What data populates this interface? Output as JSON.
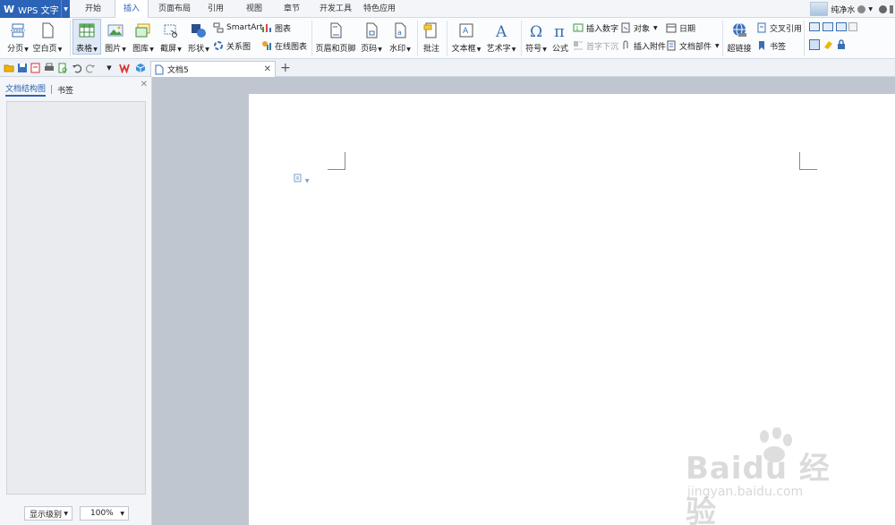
{
  "app": {
    "logo": "W",
    "title": "WPS 文字"
  },
  "menu": {
    "tabs": [
      "开始",
      "插入",
      "页面布局",
      "引用",
      "视图",
      "章节",
      "开发工具",
      "特色应用"
    ],
    "active_index": 1
  },
  "user": {
    "name": "纯净水"
  },
  "ribbon": {
    "page_break": "分页",
    "blank_page": "空白页",
    "table": "表格",
    "picture": "图片",
    "gallery": "图库",
    "screenshot": "截屏",
    "shape": "形状",
    "smartart": "SmartArt",
    "chart": "图表",
    "relation_chart": "关系图",
    "online_chart": "在线图表",
    "header_footer": "页眉和页脚",
    "page_number": "页码",
    "watermark": "水印",
    "comment": "批注",
    "textbox": "文本框",
    "wordart": "艺术字",
    "symbol": "符号",
    "formula": "公式",
    "insert_number": "插入数字",
    "object": "对象",
    "date": "日期",
    "drop_cap": "首字下沉",
    "insert_attachment": "插入附件",
    "doc_parts": "文档部件",
    "hyperlink": "超链接",
    "cross_ref": "交叉引用",
    "bookmark": "书签"
  },
  "document_tab": {
    "name": "文档5"
  },
  "left_pane": {
    "tabs": [
      "文档结构图",
      "书签"
    ],
    "level_select": "显示级别",
    "zoom_select": "100%"
  },
  "watermark": {
    "brand": "Baidu 经验",
    "url": "jingyan.baidu.com"
  },
  "colors": {
    "accent": "#2b63b6",
    "workspace": "#bfc6cf"
  }
}
